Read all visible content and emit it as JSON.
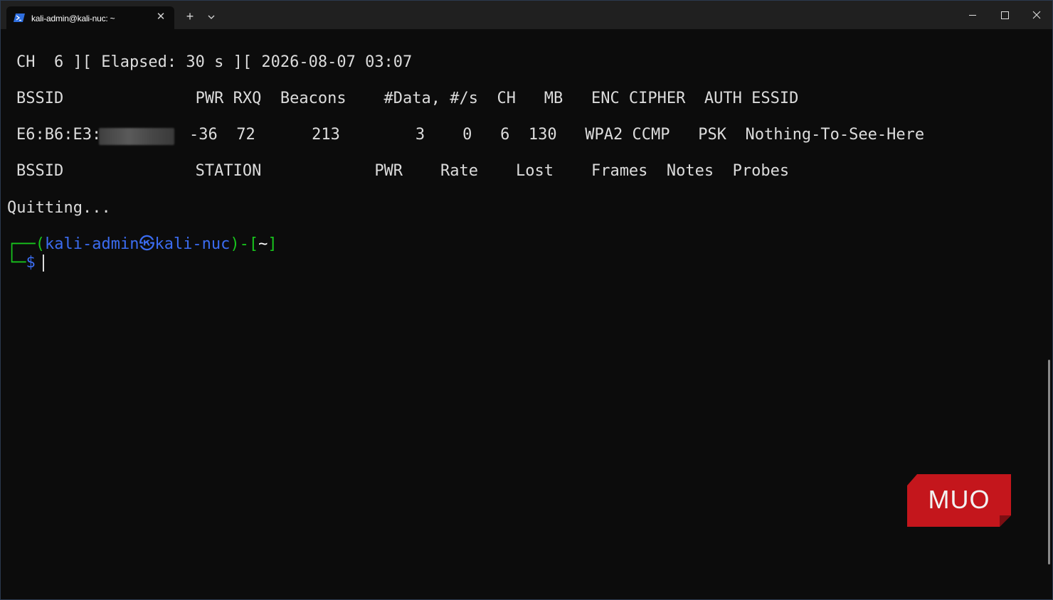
{
  "window": {
    "tab_title": "kali-admin@kali-nuc: ~",
    "tab_close": "✕",
    "new_tab": "+"
  },
  "terminal": {
    "status_line": "CH  6 ][ Elapsed: 30 s ][ 2026-08-07 03:07",
    "ap_header": "BSSID              PWR RXQ  Beacons    #Data, #/s  CH   MB   ENC CIPHER  AUTH ESSID",
    "ap_row": {
      "bssid_prefix": "E6:B6:E3:",
      "rest": "-36  72      213        3    0   6  130   WPA2 CCMP   PSK  Nothing-To-See-Here"
    },
    "station_header": "BSSID              STATION            PWR    Rate    Lost    Frames  Notes  Probes",
    "quitting": "Quitting...",
    "prompt": {
      "box_top": "┌──(",
      "user": "kali-admin",
      "at_symbol": "㉿",
      "host": "kali-nuc",
      "mid": ")-[",
      "path": "~",
      "close": "]",
      "box_bottom": "└─",
      "dollar": "$"
    }
  },
  "logo": {
    "text": "MUO",
    "color": "#c4161c"
  },
  "colors": {
    "background": "#0c0c0c",
    "titlebar": "#202020",
    "prompt_green": "#18c51d",
    "prompt_blue": "#3b6cf0"
  }
}
